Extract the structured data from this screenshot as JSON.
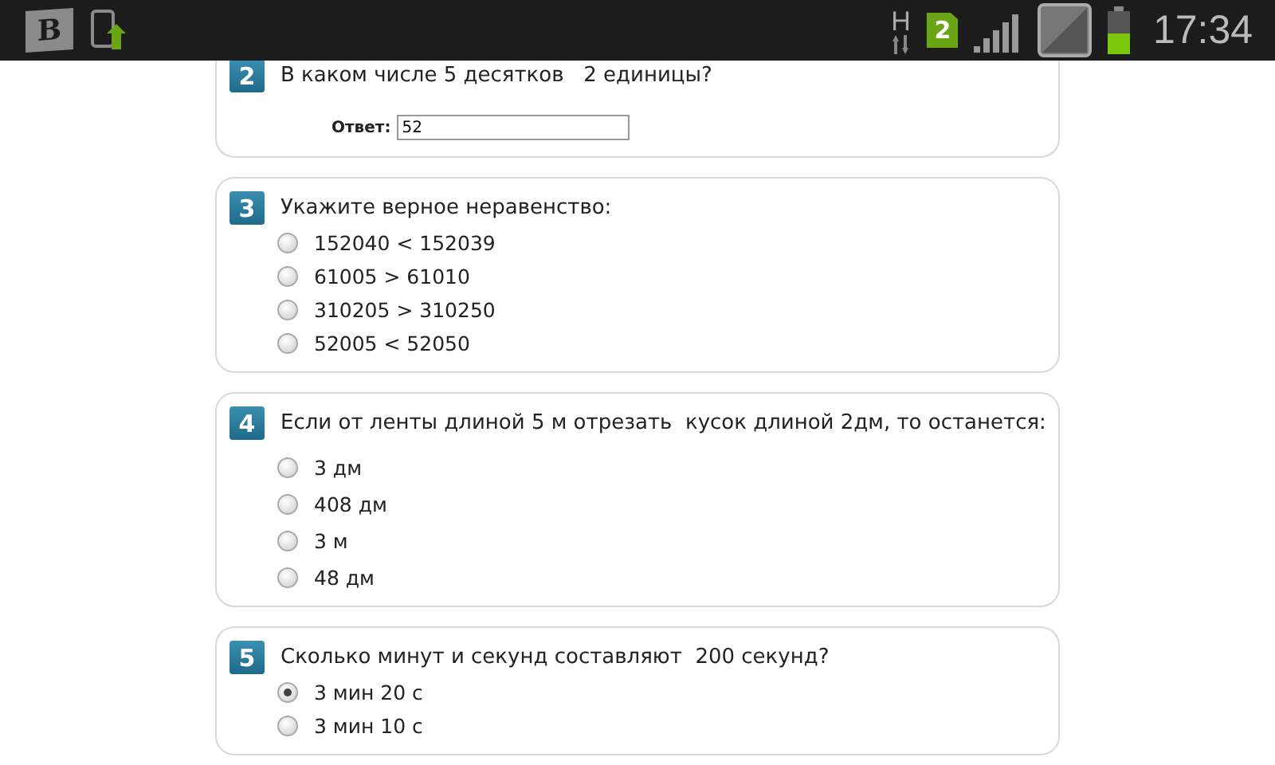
{
  "status_bar": {
    "app_logo": "B",
    "network": "H",
    "sim": "2",
    "time": "17:34"
  },
  "questions": [
    {
      "number": "2",
      "text": "В каком числе 5 десятков   2 единицы?",
      "kind": "input",
      "answer_label": "Ответ:",
      "answer_value": "52"
    },
    {
      "number": "3",
      "text": "Укажите верное неравенство:",
      "kind": "choice",
      "options": [
        {
          "label": "152040 < 152039",
          "selected": false
        },
        {
          "label": "61005 > 61010",
          "selected": false
        },
        {
          "label": "310205 > 310250",
          "selected": false
        },
        {
          "label": "52005 < 52050",
          "selected": false
        }
      ]
    },
    {
      "number": "4",
      "text": "Если от ленты длиной 5 м отрезать  кусок длиной 2дм, то останется:",
      "kind": "choice",
      "options": [
        {
          "label": "3 дм",
          "selected": false
        },
        {
          "label": "408 дм",
          "selected": false
        },
        {
          "label": "3 м",
          "selected": false
        },
        {
          "label": "48 дм",
          "selected": false
        }
      ]
    },
    {
      "number": "5",
      "text": "Сколько минут и секунд составляют  200 секунд?",
      "kind": "choice",
      "options": [
        {
          "label": "3 мин 20 с",
          "selected": true
        },
        {
          "label": "3 мин 10 с",
          "selected": false
        }
      ]
    }
  ]
}
